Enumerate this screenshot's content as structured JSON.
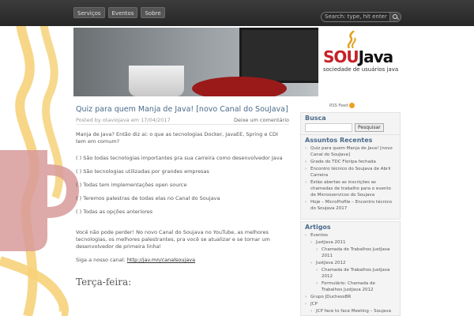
{
  "nav": {
    "items": [
      "Serviços",
      "Eventos",
      "Sobre"
    ]
  },
  "search": {
    "placeholder": "Search: type, hit enter"
  },
  "banner": {
    "logo_sou": "SOU",
    "logo_java": "Java",
    "logo_sub": "sociedade de usuários java"
  },
  "post": {
    "title": "Quiz para quem Manja de Java! [novo Canal do SouJava]",
    "meta": {
      "posted_by": "Posted by",
      "author": "otaviojava",
      "on": "em",
      "date": "17/04/2017",
      "comments_link": "Deixe um comentário"
    },
    "intro": "Manja de Java? Então diz ai: o que as tecnologias Docker, JavaEE, Spring e CDI tem em comum?",
    "options": [
      "(   ) São todas tecnologias importantes pra sua carreira como desenvolvedor Java",
      "(   ) São tecnologias utilizadas por grandes empresas",
      "(   ) Todas tem implementações open source",
      "(   ) Teremos palestras de todas elas no Canal do Soujava",
      "(   ) Todas as opções anteriores"
    ],
    "cta": "Você não pode perder! No novo Canal do Soujava no YouTube, as melhores tecnologias, os melhores palestrantes, pra você se atualizar e se tornar um desenvolvedor de primeira linha!",
    "sign_text": "Siga a nosso canal:",
    "sign_link": "http://jav.mn/canalsoujava",
    "next_heading": "Terça-feira:"
  },
  "sidebar": {
    "rss_label": "RSS Feed",
    "busca": {
      "title": "Busca",
      "button": "Pesquisar"
    },
    "recent": {
      "title": "Assuntos Recentes",
      "items": [
        "Quiz para quem Manja de Java! [novo Canal do SouJava]",
        "Grade do TDC Floripa fechada",
        "Encontro técnico do Soujava de Abril Carreira",
        "Estão abertas as inscrições as chamadas de trabalho para o evento de Microsservicos do Soujava",
        "Hoje – MicroProfile – Encontro técnico do Soujava 2017"
      ]
    },
    "articles": {
      "title": "Artigos",
      "items": [
        {
          "label": "Eventos",
          "level": 1
        },
        {
          "label": "JustJava 2011",
          "level": 2
        },
        {
          "label": "Chamada de Trabalhos JustJava 2011",
          "level": 3
        },
        {
          "label": "JustJava 2012",
          "level": 2
        },
        {
          "label": "Chamada de Trabalhos JustJava 2012",
          "level": 3
        },
        {
          "label": "Formulário: Chamada de Trabalhos JustJava 2012",
          "level": 3
        },
        {
          "label": "Grupo JDuchessBR",
          "level": 1
        },
        {
          "label": "JCP",
          "level": 1
        },
        {
          "label": "JCP face to face Meeting – Soujava",
          "level": 2
        }
      ]
    }
  }
}
